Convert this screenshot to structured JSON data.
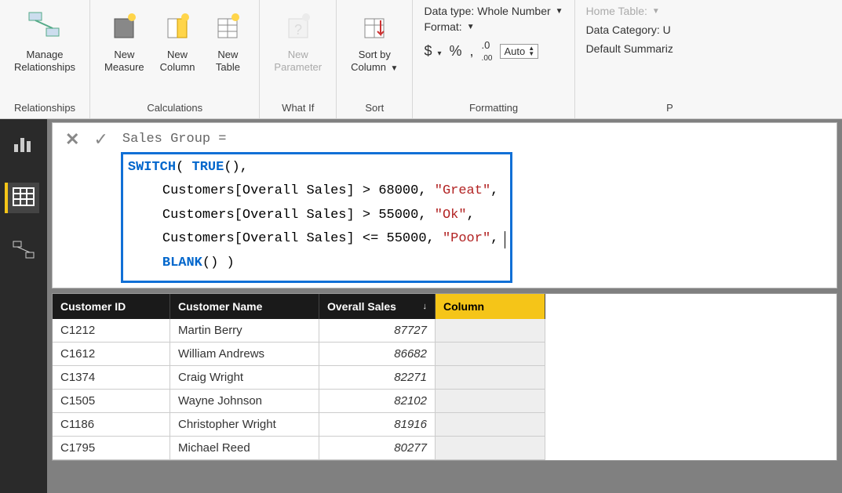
{
  "ribbon": {
    "relationships": {
      "manage": "Manage\nRelationships",
      "group": "Relationships"
    },
    "calculations": {
      "measure": "New\nMeasure",
      "column": "New\nColumn",
      "table": "New\nTable",
      "group": "Calculations"
    },
    "whatif": {
      "param": "New\nParameter",
      "group": "What If"
    },
    "sort": {
      "sortby": "Sort by\nColumn",
      "group": "Sort"
    },
    "formatting": {
      "datatype_label": "Data type:",
      "datatype_value": "Whole Number",
      "format_label": "Format:",
      "currency": "$",
      "percent": "%",
      "comma": ",",
      "decimals_icon": ".00",
      "auto": "Auto",
      "group": "Formatting"
    },
    "props": {
      "hometable": "Home Table:",
      "datacat": "Data Category: U",
      "defsum": "Default Summariz",
      "group": "P"
    }
  },
  "formula": {
    "line1": "Sales Group =",
    "switch": "SWITCH",
    "true": "TRUE",
    "ref": "Customers[Overall Sales]",
    "gt68": "> 68000,",
    "great": "\"Great\"",
    "gt55": "> 55000,",
    "ok": "\"Ok\"",
    "lte55": "<= 55000,",
    "poor": "\"Poor\"",
    "blank": "BLANK"
  },
  "grid": {
    "headers": {
      "id": "Customer ID",
      "name": "Customer Name",
      "sales": "Overall Sales",
      "col": "Column"
    },
    "rows": [
      {
        "id": "C1212",
        "name": "Martin Berry",
        "sales": "87727"
      },
      {
        "id": "C1612",
        "name": "William Andrews",
        "sales": "86682"
      },
      {
        "id": "C1374",
        "name": "Craig Wright",
        "sales": "82271"
      },
      {
        "id": "C1505",
        "name": "Wayne Johnson",
        "sales": "82102"
      },
      {
        "id": "C1186",
        "name": "Christopher Wright",
        "sales": "81916"
      },
      {
        "id": "C1795",
        "name": "Michael Reed",
        "sales": "80277"
      }
    ]
  }
}
